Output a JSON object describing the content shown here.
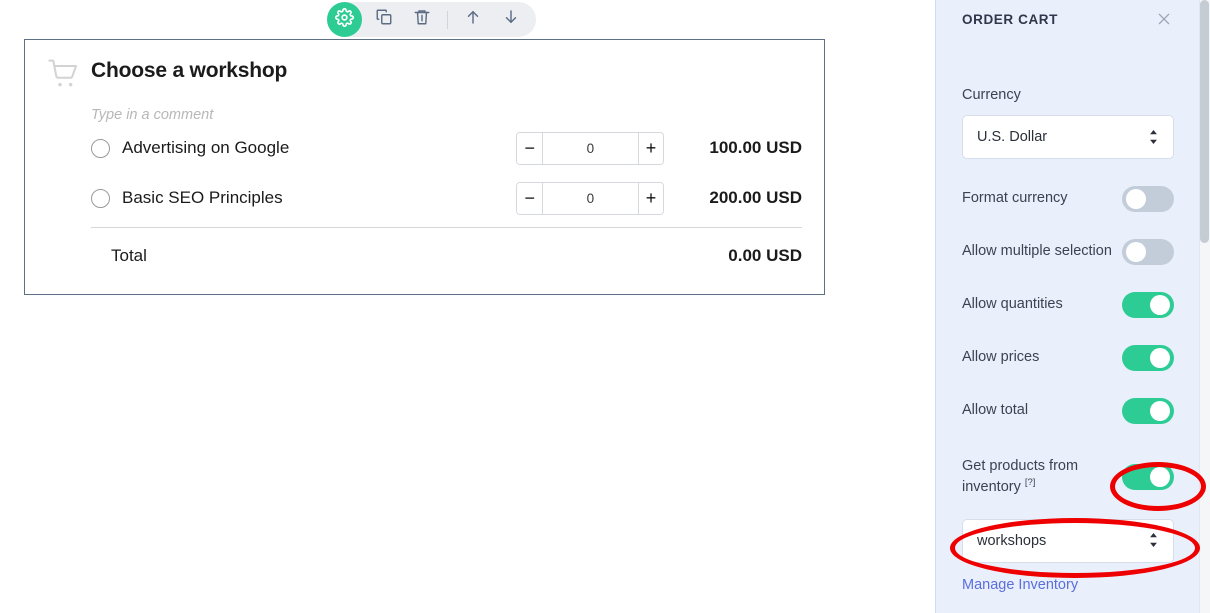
{
  "toolbar": {
    "items": [
      {
        "name": "settings-gear",
        "icon": "gear-icon",
        "active": true
      },
      {
        "name": "duplicate",
        "icon": "copy-icon",
        "active": false
      },
      {
        "name": "delete",
        "icon": "trash-icon",
        "active": false
      },
      {
        "name": "move-up",
        "icon": "arrow-up-icon",
        "active": false
      },
      {
        "name": "move-down",
        "icon": "arrow-down-icon",
        "active": false
      }
    ],
    "accent_color": "#2ecc95"
  },
  "card": {
    "icon": "shopping-cart-icon",
    "title": "Choose a workshop",
    "comment_placeholder": "Type in a comment",
    "options": [
      {
        "label": "Advertising on Google",
        "quantity": "0",
        "price": "100.00 USD"
      },
      {
        "label": "Basic SEO Principles",
        "quantity": "0",
        "price": "200.00 USD"
      }
    ],
    "stepper": {
      "minus_label": "−",
      "plus_label": "+"
    },
    "total_label": "Total",
    "total_value": "0.00 USD"
  },
  "sidebar": {
    "title": "ORDER CART",
    "close_icon": "close-icon",
    "currency": {
      "label": "Currency",
      "value": "U.S. Dollar"
    },
    "toggles": [
      {
        "label": "Format currency",
        "on": false
      },
      {
        "label": "Allow multiple selection",
        "on": false
      },
      {
        "label": "Allow quantities",
        "on": true
      },
      {
        "label": "Allow prices",
        "on": true
      },
      {
        "label": "Allow total",
        "on": true
      }
    ],
    "inventory": {
      "label": "Get products from inventory",
      "help_marker": "[?]",
      "on": true,
      "source_value": "workshops",
      "manage_link": "Manage Inventory"
    },
    "background_color": "#e9f0fb",
    "toggle_on_color": "#2ecc95",
    "toggle_off_color": "#c3cdd9",
    "link_color": "#5b6ede"
  },
  "annotations": {
    "color": "#ee0000",
    "shapes": [
      {
        "name": "inventory-toggle-highlight",
        "target": "Get products from inventory toggle"
      },
      {
        "name": "inventory-source-highlight",
        "target": "workshops select"
      }
    ]
  }
}
